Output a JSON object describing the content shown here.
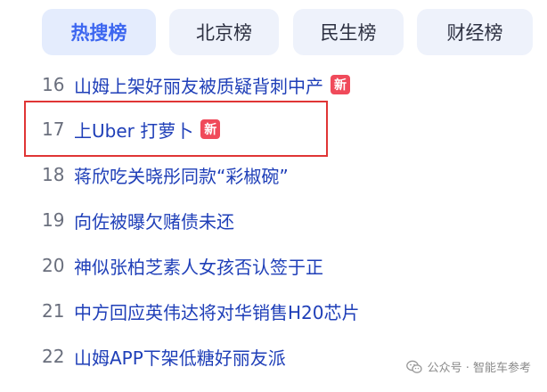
{
  "tabs": [
    {
      "label": "热搜榜",
      "active": true
    },
    {
      "label": "北京榜",
      "active": false
    },
    {
      "label": "民生榜",
      "active": false
    },
    {
      "label": "财经榜",
      "active": false
    }
  ],
  "items": [
    {
      "rank": "16",
      "title": "山姆上架好丽友被质疑背刺中产",
      "badge": "新"
    },
    {
      "rank": "17",
      "title": "上Uber 打萝卜",
      "badge": "新"
    },
    {
      "rank": "18",
      "title": "蒋欣吃关晓彤同款“彩椒碗”",
      "badge": ""
    },
    {
      "rank": "19",
      "title": "向佐被曝欠赌债未还",
      "badge": ""
    },
    {
      "rank": "20",
      "title": "神似张柏芝素人女孩否认签于正",
      "badge": ""
    },
    {
      "rank": "21",
      "title": "中方回应英伟达将对华销售H20芯片",
      "badge": ""
    },
    {
      "rank": "22",
      "title": "山姆APP下架低糖好丽友派",
      "badge": ""
    }
  ],
  "watermark": {
    "text": "公众号 · 智能车参考",
    "icon": "wechat-icon"
  },
  "colors": {
    "accent": "#3d67f0",
    "link": "#1f3fb8",
    "badge": "#f04a5a",
    "highlight": "#e03535"
  }
}
